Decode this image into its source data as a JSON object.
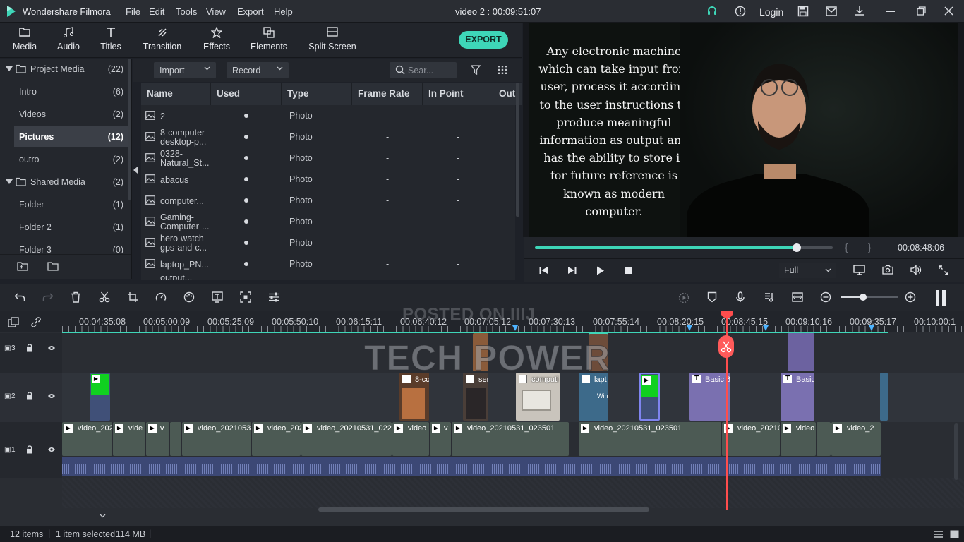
{
  "app": {
    "title": "Wondershare Filmora",
    "project_title": "video 2 : 00:09:51:07",
    "login_label": "Login"
  },
  "menu": [
    "File",
    "Edit",
    "Tools",
    "View",
    "Export",
    "Help"
  ],
  "toolbar": {
    "tabs": [
      "Media",
      "Audio",
      "Titles",
      "Transition",
      "Effects",
      "Elements",
      "Split Screen"
    ],
    "export_label": "EXPORT"
  },
  "sidebar": {
    "items": [
      {
        "label": "Project Media",
        "count": "(22)"
      },
      {
        "label": "Intro",
        "count": "(6)"
      },
      {
        "label": "Videos",
        "count": "(2)"
      },
      {
        "label": "Pictures",
        "count": "(12)"
      },
      {
        "label": "outro",
        "count": "(2)"
      },
      {
        "label": "Shared Media",
        "count": "(2)"
      },
      {
        "label": "Folder",
        "count": "(1)"
      },
      {
        "label": "Folder 2",
        "count": "(1)"
      },
      {
        "label": "Folder 3",
        "count": "(0)"
      }
    ]
  },
  "media": {
    "import_label": "Import",
    "record_label": "Record",
    "search_placeholder": "Sear...",
    "columns": [
      "Name",
      "Used",
      "Type",
      "Frame Rate",
      "In Point",
      "Out"
    ],
    "rows": [
      {
        "name": "2",
        "type": "Photo",
        "frame_rate": "-",
        "in_point": "-"
      },
      {
        "name": "8-computer-desktop-p...",
        "type": "Photo",
        "frame_rate": "-",
        "in_point": "-"
      },
      {
        "name": "0328-Natural_St...",
        "type": "Photo",
        "frame_rate": "-",
        "in_point": "-"
      },
      {
        "name": "abacus",
        "type": "Photo",
        "frame_rate": "-",
        "in_point": "-"
      },
      {
        "name": "computer...",
        "type": "Photo",
        "frame_rate": "-",
        "in_point": "-"
      },
      {
        "name": "Gaming-Computer-...",
        "type": "Photo",
        "frame_rate": "-",
        "in_point": "-"
      },
      {
        "name": "hero-watch-gps-and-c...",
        "type": "Photo",
        "frame_rate": "-",
        "in_point": "-"
      },
      {
        "name": "laptop_PN...",
        "type": "Photo",
        "frame_rate": "-",
        "in_point": "-"
      },
      {
        "name": "output...",
        "type": "",
        "frame_rate": "",
        "in_point": ""
      }
    ]
  },
  "preview": {
    "caption": "Any electronic machine which can take input from user, process it according to the user instructions to produce meaningful information as output and has the ability to store it for future reference is known as modern computer.",
    "progress": 0.88,
    "timecode": "00:08:48:06",
    "quality": "Full"
  },
  "timeline": {
    "ruler": [
      "00:04:35:08",
      "00:05:00:09",
      "00:05:25:09",
      "00:05:50:10",
      "00:06:15:11",
      "00:06:40:12",
      "00:07:05:12",
      "00:07:30:13",
      "00:07:55:14",
      "00:08:20:15",
      "00:08:45:15",
      "00:09:10:16",
      "00:09:35:17",
      "00:10:00:1"
    ],
    "watermark_small": "POSTED ON IIIJ",
    "watermark_large": "TECH POWER",
    "track_labels": [
      "3",
      "2",
      "1"
    ],
    "track2_clips": [
      "8-co",
      "ser",
      "computi",
      "lapt",
      "Win",
      "Basic 6",
      "Basic"
    ],
    "track1_clips": [
      "video_202",
      "vide",
      "v",
      "video_20210531_",
      "video_202",
      "video_20210531_022",
      "video",
      "v",
      "video_20210531_023501",
      "video_20210531_023501",
      "video_20210",
      "video",
      "video_2"
    ]
  },
  "status": {
    "items": "12 items",
    "selected": "1 item selected",
    "size": "114 MB"
  },
  "colors": {
    "accent": "#3ed6b8",
    "playhead": "#ff4d4d",
    "clip_title": "#7a70b0",
    "selection": "#5b5fd8"
  }
}
